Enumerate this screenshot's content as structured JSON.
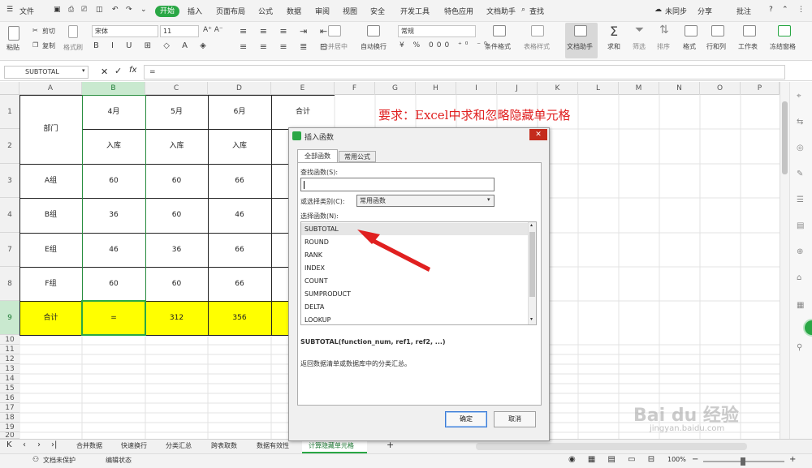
{
  "menu": {
    "file": "文件",
    "tabs": [
      "开始",
      "插入",
      "页面布局",
      "公式",
      "数据",
      "审阅",
      "视图",
      "安全",
      "开发工具",
      "特色应用",
      "文档助手"
    ],
    "search": "查找",
    "sync": "未同步",
    "share": "分享",
    "comment": "批注",
    "help": "?"
  },
  "ribbon": {
    "paste": "粘贴",
    "cut": "剪切",
    "copy": "复制",
    "format_painter": "格式刷",
    "font_name": "宋体",
    "font_size": "11",
    "merge_center": "合并居中",
    "wrap_text": "自动换行",
    "number_format": "常规",
    "conditional_format": "条件格式",
    "table_style": "表格样式",
    "doc_assistant": "文档助手",
    "sum": "求和",
    "filter": "筛选",
    "sort": "排序",
    "format": "格式",
    "row_col": "行和列",
    "worksheet": "工作表",
    "freeze": "冻结窗格"
  },
  "formula_bar": {
    "name_box": "SUBTOTAL",
    "cancel": "✕",
    "confirm": "✓",
    "fx": "fx",
    "content": "="
  },
  "columns": [
    "A",
    "B",
    "C",
    "D",
    "E",
    "F",
    "G",
    "H",
    "I",
    "J",
    "K",
    "L",
    "M",
    "N",
    "O",
    "P"
  ],
  "rows": [
    "1",
    "2",
    "3",
    "4",
    "7",
    "8",
    "9",
    "10",
    "11",
    "12",
    "13",
    "14",
    "15",
    "16",
    "17",
    "18",
    "19",
    "20",
    "21",
    "22",
    "23",
    "24",
    "25",
    "26"
  ],
  "table": {
    "dept_header": "部门",
    "months": [
      "4月",
      "5月",
      "6月",
      "合计"
    ],
    "sub_headers": [
      "入库",
      "入库",
      "入库"
    ],
    "groups": [
      "A组",
      "B组",
      "E组",
      "F组"
    ],
    "values": [
      [
        "60",
        "60",
        "66"
      ],
      [
        "36",
        "60",
        "46"
      ],
      [
        "46",
        "36",
        "66"
      ],
      [
        "60",
        "60",
        "66"
      ]
    ],
    "total_label": "合计",
    "totals": [
      "=",
      "312",
      "356"
    ]
  },
  "annotation": "要求：Excel中求和忽略隐藏单元格",
  "dialog": {
    "title": "插入函数",
    "tabs": [
      "全部函数",
      "常用公式"
    ],
    "search_label": "查找函数(S):",
    "category_label": "或选择类别(C):",
    "category_value": "常用函数",
    "select_label": "选择函数(N):",
    "functions": [
      "SUBTOTAL",
      "ROUND",
      "RANK",
      "INDEX",
      "COUNT",
      "SUMPRODUCT",
      "DELTA",
      "LOOKUP"
    ],
    "signature": "SUBTOTAL(function_num, ref1, ref2, ...)",
    "description": "返回数据清单或数据库中的分类汇总。",
    "ok": "确定",
    "cancel": "取消"
  },
  "sheet_tabs": [
    "合并数据",
    "快速换行",
    "分类汇总",
    "跨表取数",
    "数据有效性",
    "计算隐藏单元格"
  ],
  "active_sheet_index": 5,
  "status": {
    "doc_protect": "文档未保护",
    "edit_mode": "编辑状态",
    "zoom": "100%"
  },
  "watermark": {
    "line1": "Bai du 经验",
    "line2": "jingyan.baidu.com"
  },
  "colors": {
    "accent": "#2aa745",
    "yellow": "#ffff00",
    "red": "#e02020"
  }
}
